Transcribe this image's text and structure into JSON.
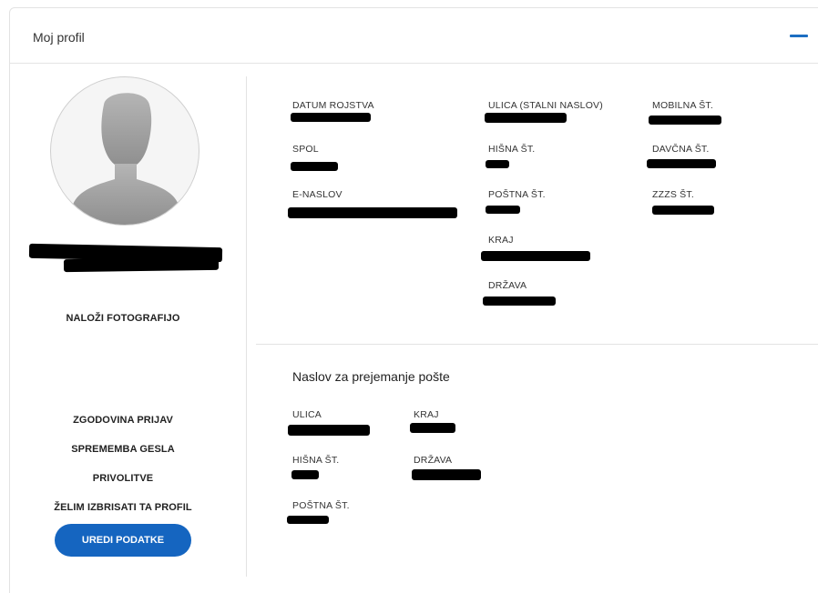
{
  "card": {
    "title": "Moj profil",
    "collapse_icon": "minus-icon",
    "accent": "#1c6ec2"
  },
  "left": {
    "avatar_icon": "default-user-avatar-icon",
    "upload_photo": "NALOŽI FOTOGRAFIJO",
    "links": [
      "ZGODOVINA PRIJAV",
      "SPREMEMBA GESLA",
      "PRIVOLITVE",
      "ŽELIM IZBRISATI TA PROFIL"
    ],
    "edit_button": "UREDI PODATKE",
    "edit_button_color": "#1565c0"
  },
  "personal": {
    "birth_date": {
      "label": "DATUM ROJSTVA",
      "value": ""
    },
    "gender": {
      "label": "SPOL",
      "value": ""
    },
    "email": {
      "label": "E-NASLOV",
      "value": ""
    },
    "street": {
      "label": "ULICA (STALNI NASLOV)",
      "value": ""
    },
    "house_no": {
      "label": "HIŠNA ŠT.",
      "value": ""
    },
    "postal_no": {
      "label": "POŠTNA ŠT.",
      "value": ""
    },
    "city": {
      "label": "KRAJ",
      "value": ""
    },
    "country": {
      "label": "DRŽAVA",
      "value": ""
    },
    "mobile": {
      "label": "MOBILNA ŠT.",
      "value": ""
    },
    "tax_no": {
      "label": "DAVČNA ŠT.",
      "value": ""
    },
    "zzzs_no": {
      "label": "ZZZS ŠT.",
      "value": ""
    }
  },
  "mailing": {
    "title": "Naslov za prejemanje pošte",
    "street": {
      "label": "ULICA",
      "value": ""
    },
    "house_no": {
      "label": "HIŠNA ŠT.",
      "value": ""
    },
    "postal_no": {
      "label": "POŠTNA ŠT.",
      "value": ""
    },
    "city": {
      "label": "KRAJ",
      "value": ""
    },
    "country": {
      "label": "DRŽAVA",
      "value": ""
    }
  }
}
